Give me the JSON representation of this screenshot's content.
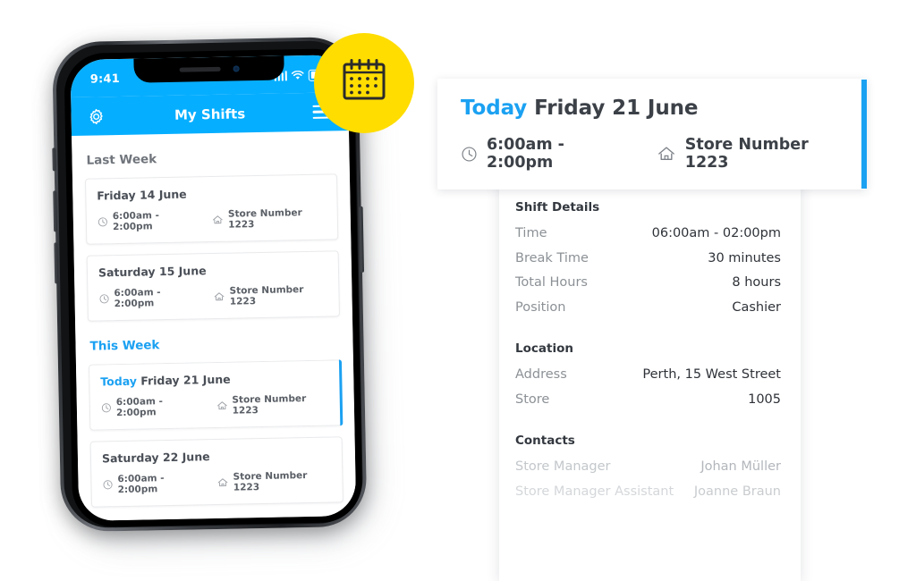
{
  "phone": {
    "status_bar": {
      "time": "9:41",
      "icons": [
        "signal-bars-icon",
        "wifi-icon",
        "battery-icon"
      ]
    },
    "app_bar": {
      "settings_icon": "gear-icon",
      "title": "My Shifts",
      "menu_icon": "hamburger-menu-icon"
    },
    "sections": [
      {
        "heading": "Last Week",
        "accent": false,
        "shifts": [
          {
            "today_label": "",
            "date": "Friday 14 June",
            "time": "6:00am - 2:00pm",
            "store": "Store Number 1223",
            "active": false
          },
          {
            "today_label": "",
            "date": "Saturday 15 June",
            "time": "6:00am - 2:00pm",
            "store": "Store Number 1223",
            "active": false
          }
        ]
      },
      {
        "heading": "This Week",
        "accent": true,
        "shifts": [
          {
            "today_label": "Today",
            "date": "Friday 21 June",
            "time": "6:00am - 2:00pm",
            "store": "Store Number 1223",
            "active": true
          },
          {
            "today_label": "",
            "date": "Saturday 22 June",
            "time": "6:00am - 2:00pm",
            "store": "Store Number 1223",
            "active": false
          }
        ]
      }
    ]
  },
  "badge": {
    "icon": "calendar-icon",
    "color": "#FFDD00"
  },
  "summary": {
    "today_label": "Today",
    "date": "Friday 21 June",
    "time": "6:00am - 2:00pm",
    "store": "Store Number 1223",
    "accent_color": "#1BA1F2"
  },
  "details": {
    "shift_details": {
      "title": "Shift Details",
      "rows": [
        {
          "key": "Time",
          "value": "06:00am - 02:00pm"
        },
        {
          "key": "Break Time",
          "value": "30 minutes"
        },
        {
          "key": "Total Hours",
          "value": "8 hours"
        },
        {
          "key": "Position",
          "value": "Cashier"
        }
      ]
    },
    "location": {
      "title": "Location",
      "rows": [
        {
          "key": "Address",
          "value": "Perth, 15 West Street"
        },
        {
          "key": "Store",
          "value": "1005"
        }
      ]
    },
    "contacts": {
      "title": "Contacts",
      "rows": [
        {
          "key": "Store Manager",
          "value": "Johan Müller"
        },
        {
          "key": "Store Manager Assistant",
          "value": "Joanne Braun"
        }
      ]
    }
  }
}
